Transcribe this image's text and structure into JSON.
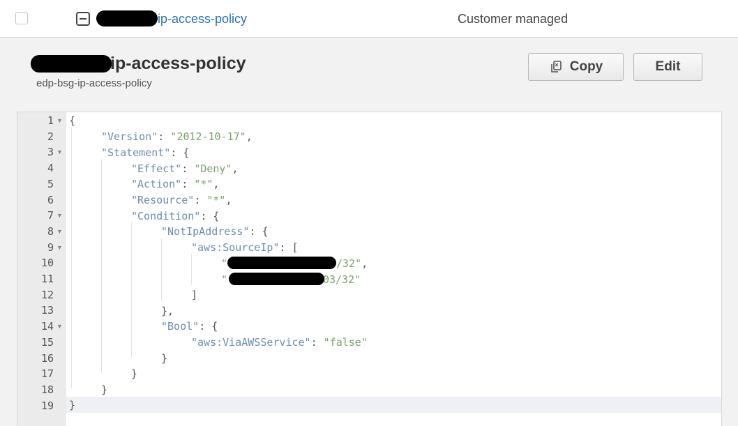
{
  "list_row": {
    "policy_name": "ip-access-policy",
    "policy_type": "Customer managed"
  },
  "detail": {
    "title": "ip-access-policy",
    "subtitle": "edp-bsg-ip-access-policy",
    "copy_label": "Copy",
    "edit_label": "Edit"
  },
  "editor": {
    "line_numbers": [
      "1",
      "2",
      "3",
      "4",
      "5",
      "6",
      "7",
      "8",
      "9",
      "10",
      "11",
      "12",
      "13",
      "14",
      "15",
      "16",
      "17",
      "18",
      "19"
    ],
    "foldable_lines": [
      1,
      3,
      7,
      8,
      9,
      14
    ],
    "active_line": 19,
    "code": {
      "version_key": "\"Version\"",
      "version_val": "\"2012-10-17\"",
      "statement_key": "\"Statement\"",
      "effect_key": "\"Effect\"",
      "effect_val": "\"Deny\"",
      "action_key": "\"Action\"",
      "action_val": "\"*\"",
      "resource_key": "\"Resource\"",
      "resource_val": "\"*\"",
      "condition_key": "\"Condition\"",
      "notip_key": "\"NotIpAddress\"",
      "sourceip_key": "\"aws:SourceIp\"",
      "ip1_prefix": "\"",
      "ip1_suffix": "/32\"",
      "ip2_prefix": "\"",
      "ip2_suffix": "03/32\"",
      "bool_key": "\"Bool\"",
      "via_key": "\"aws:ViaAWSService\"",
      "via_val": "\"false\""
    }
  }
}
